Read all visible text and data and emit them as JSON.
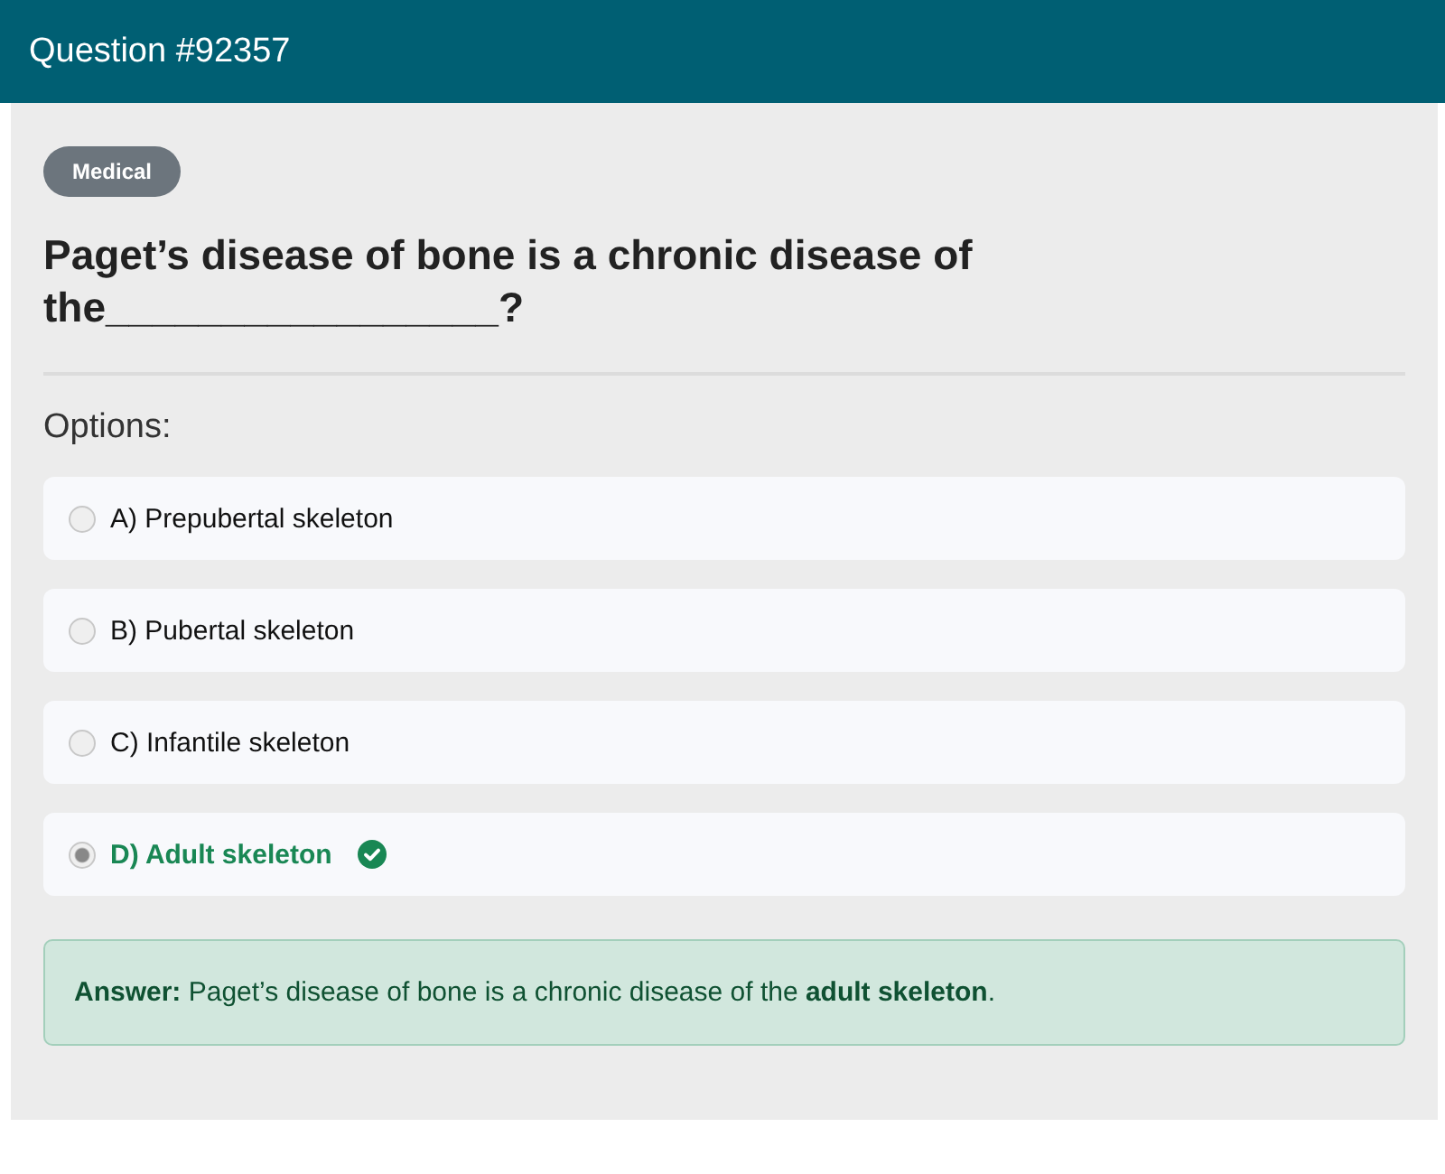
{
  "header": {
    "title": "Question #92357"
  },
  "category_badge": "Medical",
  "question": "Paget’s disease of bone is a chronic disease of the_________________?",
  "options_heading": "Options:",
  "options": [
    {
      "label": "A) Prepubertal skeleton",
      "selected": false,
      "correct": false
    },
    {
      "label": "B) Pubertal skeleton",
      "selected": false,
      "correct": false
    },
    {
      "label": "C) Infantile skeleton",
      "selected": false,
      "correct": false
    },
    {
      "label": "D) Adult skeleton",
      "selected": true,
      "correct": true
    }
  ],
  "answer": "**Answer:** Paget’s disease of bone is a chronic disease of the **adult skeleton**."
}
